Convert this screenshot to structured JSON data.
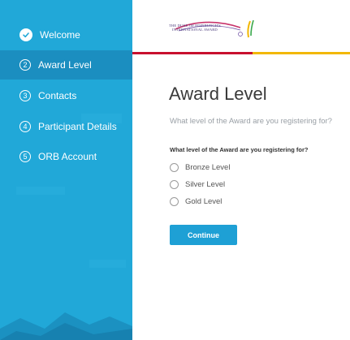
{
  "colors": {
    "sidebar": "#21a8d8",
    "sidebar_active": "#1b8ec0",
    "button": "#1ea0d5",
    "stripe_red": "#c8102e",
    "stripe_yellow": "#f2b705"
  },
  "sidebar": {
    "items": [
      {
        "step": "",
        "icon": "check-circle-icon",
        "label": "Welcome",
        "state": "completed"
      },
      {
        "step": "2",
        "label": "Award Level",
        "state": "active"
      },
      {
        "step": "3",
        "label": "Contacts",
        "state": "pending"
      },
      {
        "step": "4",
        "label": "Participant Details",
        "state": "pending"
      },
      {
        "step": "5",
        "label": "ORB Account",
        "state": "pending"
      }
    ]
  },
  "header": {
    "logo": {
      "line1": "THE DUKE OF EDINBURGH'S",
      "line2": "INTERNATIONAL AWARD"
    }
  },
  "main": {
    "title": "Award Level",
    "subtitle": "What level of the Award are you registering for?",
    "question": "What level of the Award are you registering for?",
    "options": [
      "Bronze Level",
      "Silver Level",
      "Gold Level"
    ],
    "continue_label": "Continue"
  }
}
